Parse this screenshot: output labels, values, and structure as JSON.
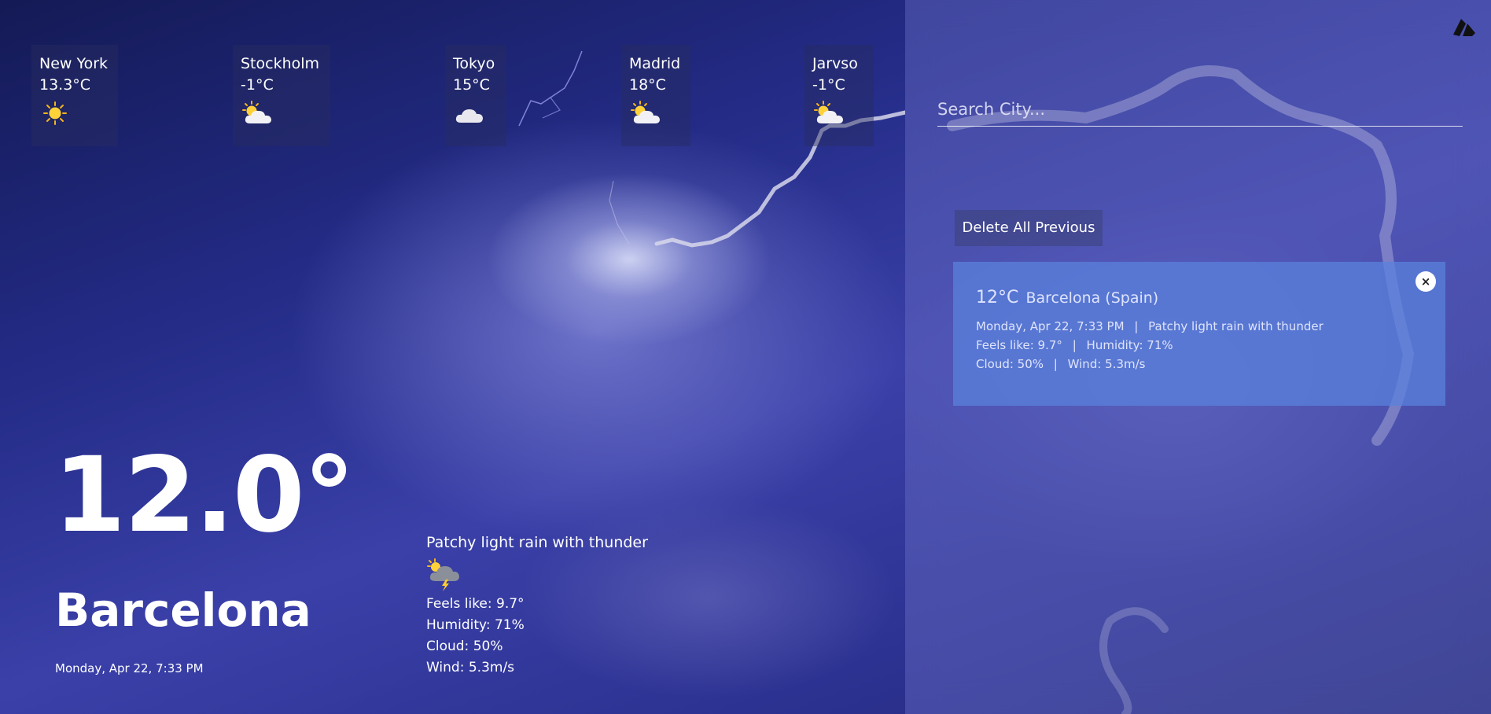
{
  "cities": [
    {
      "name": "New York",
      "temp": "13.3°C",
      "icon": "sun-icon"
    },
    {
      "name": "Stockholm",
      "temp": "-1°C",
      "icon": "partly-cloudy-icon"
    },
    {
      "name": "Tokyo",
      "temp": "15°C",
      "icon": "cloud-icon"
    },
    {
      "name": "Madrid",
      "temp": "18°C",
      "icon": "partly-cloudy-icon"
    },
    {
      "name": "Jarvso",
      "temp": "-1°C",
      "icon": "partly-cloudy-icon"
    }
  ],
  "current": {
    "temperature": "12.0°",
    "city": "Barcelona",
    "datetime": "Monday, Apr 22, 7:33 PM",
    "condition": "Patchy light rain with thunder",
    "condition_icon": "thunder-rain-icon",
    "feels_like": "Feels like: 9.7°",
    "humidity": "Humidity: 71%",
    "cloud": "Cloud: 50%",
    "wind": "Wind: 5.3m/s"
  },
  "search": {
    "placeholder": "Search City..."
  },
  "history": {
    "delete_label": "Delete All Previous",
    "close_symbol": "×",
    "items": [
      {
        "temp": "12°C",
        "city": "Barcelona (Spain)",
        "datetime": "Monday, Apr 22, 7:33 PM",
        "condition": "Patchy light rain with thunder",
        "feels_like": "Feels like: 9.7°",
        "humidity": "Humidity: 71%",
        "cloud": "Cloud: 50%",
        "wind": "Wind: 5.3m/s"
      }
    ]
  },
  "separator": "|",
  "logo_icon": "app-logo-icon"
}
